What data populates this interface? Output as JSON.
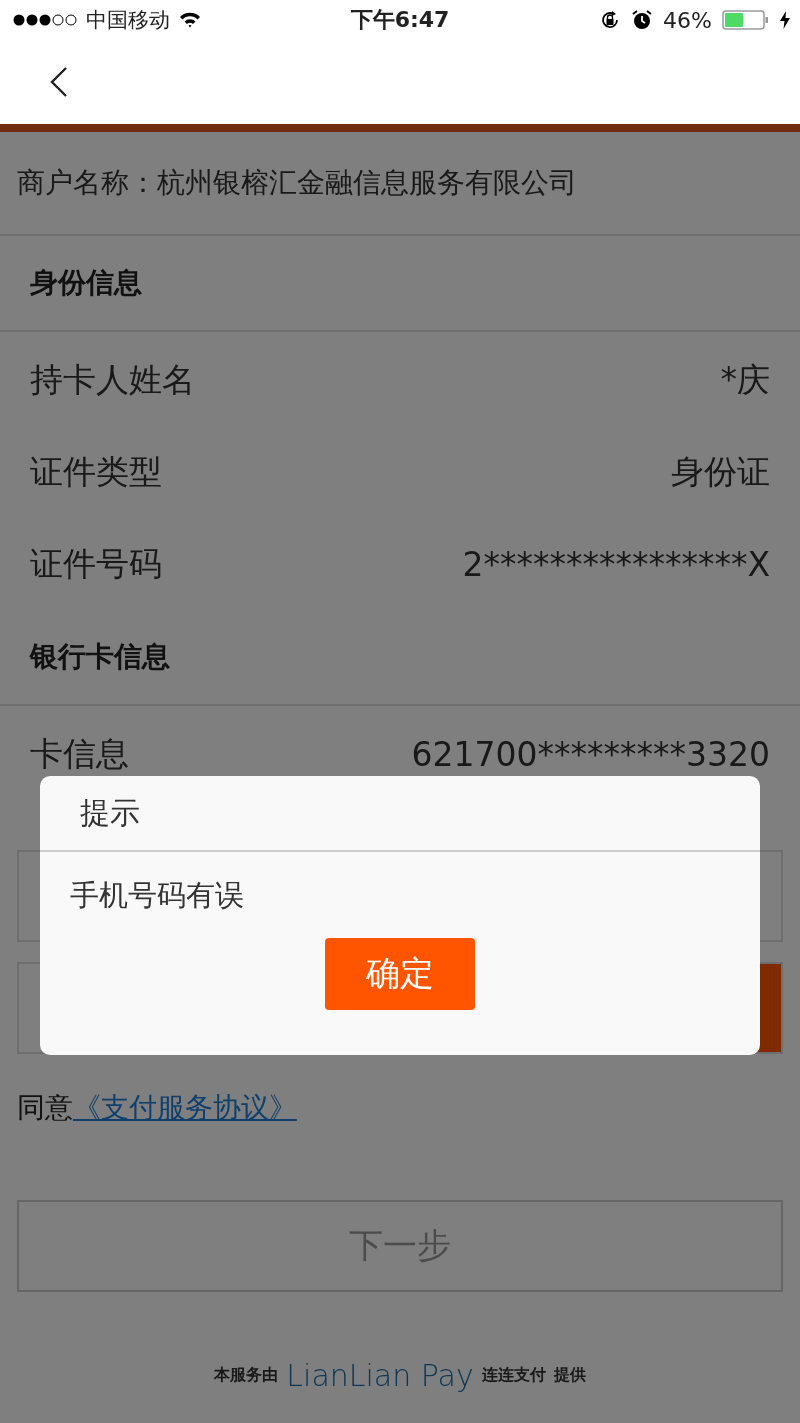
{
  "status_bar": {
    "carrier": "中国移动",
    "time": "下午6:47",
    "battery": "46%"
  },
  "merchant": "商户名称：杭州银榕汇金融信息服务有限公司",
  "sections": [
    {
      "title": "身份信息",
      "rows": [
        {
          "label": "持卡人姓名",
          "value": "*庆"
        },
        {
          "label": "证件类型",
          "value": "身份证"
        },
        {
          "label": "证件号码",
          "value": "2****************X"
        }
      ]
    },
    {
      "title": "银行卡信息",
      "rows": [
        {
          "label": "卡信息",
          "value": "621700*********3320"
        }
      ]
    }
  ],
  "agreement": {
    "text": "同意",
    "link": "《支付服务协议》"
  },
  "next_button": "下一步",
  "footer": {
    "prefix": "本服务由",
    "brand": "LianLian Pay",
    "name": "连连支付",
    "suffix": "提供"
  },
  "dialog": {
    "title": "提示",
    "message": "手机号码有误",
    "button": "确定"
  }
}
